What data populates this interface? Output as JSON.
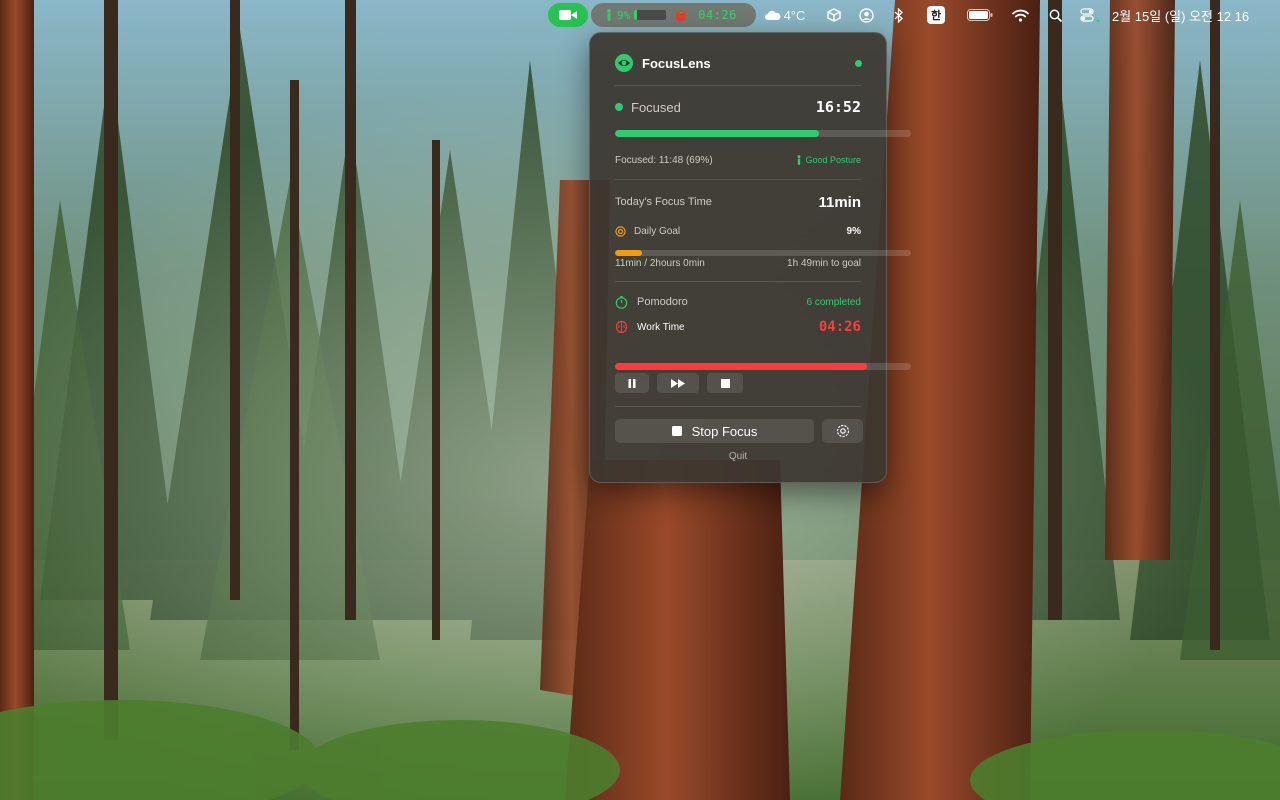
{
  "menubar": {
    "focus_pct": "9%",
    "focus_level": 0.09,
    "pomodoro_time": "04:26",
    "weather": "4°C",
    "input_method": "한",
    "datetime": "2월 15일 (일) 오전 12 16"
  },
  "popover": {
    "app_name": "FocusLens",
    "status": {
      "label": "Focused",
      "session_time": "16:52",
      "progress": 0.69,
      "detail": "Focused: 11:48 (69%)",
      "posture": "Good Posture"
    },
    "today": {
      "label": "Today's Focus Time",
      "value": "11min",
      "goal_label": "Daily Goal",
      "goal_pct": "9%",
      "goal_progress": 0.09,
      "goal_detail": "11min / 2hours 0min",
      "goal_remaining": "1h 49min to goal"
    },
    "pomodoro": {
      "label": "Pomodoro",
      "completed": "6 completed",
      "phase": "Work Time",
      "time": "04:26",
      "progress": 0.85
    },
    "actions": {
      "stop_label": "Stop Focus",
      "quit_label": "Quit"
    }
  },
  "colors": {
    "accent_green": "#2ecc71",
    "timer_red": "#ff3b3b",
    "goal_orange": "#f39c12",
    "camera_green": "#27c251"
  }
}
